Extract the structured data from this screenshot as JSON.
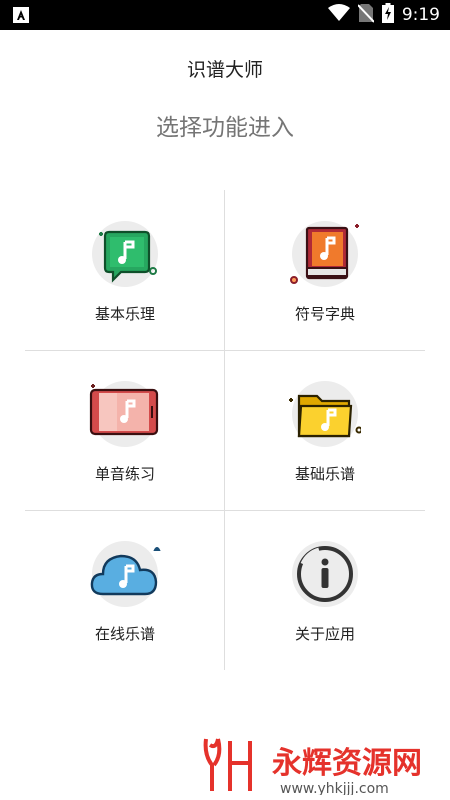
{
  "status_bar": {
    "time": "9:19",
    "icons": [
      "app-notification-icon",
      "wifi-icon",
      "no-sim-icon",
      "battery-charging-icon"
    ]
  },
  "header": {
    "title": "识谱大师",
    "subtitle": "选择功能进入"
  },
  "menu": {
    "items": [
      {
        "label": "基本乐理",
        "icon": "music-chat-icon",
        "color": "#27a760"
      },
      {
        "label": "符号字典",
        "icon": "music-book-icon",
        "color": "#e8702a"
      },
      {
        "label": "单音练习",
        "icon": "music-tablet-icon",
        "color": "#f1a9a0"
      },
      {
        "label": "基础乐谱",
        "icon": "music-folder-icon",
        "color": "#f6c21c"
      },
      {
        "label": "在线乐谱",
        "icon": "music-cloud-icon",
        "color": "#5aaee0"
      },
      {
        "label": "关于应用",
        "icon": "info-icon",
        "color": "#333333"
      }
    ]
  },
  "watermark": {
    "brand": "永辉资源网",
    "url": "www.yhkjjj.com"
  }
}
